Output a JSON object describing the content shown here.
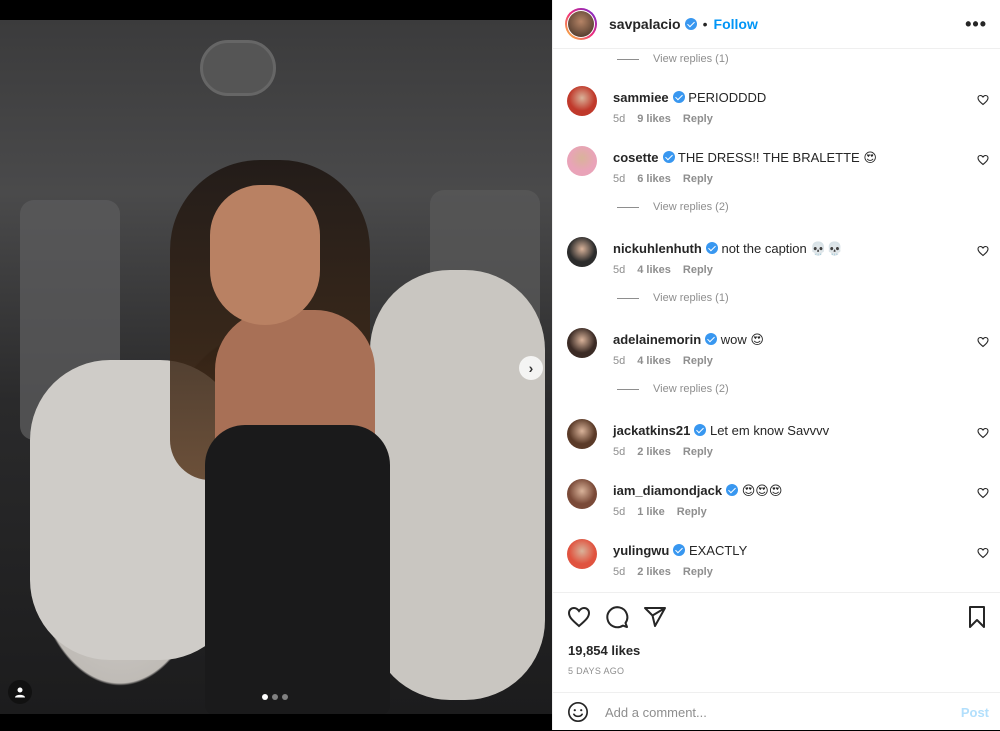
{
  "post": {
    "author": "savpalacio",
    "follow_label": "Follow",
    "separator": "•",
    "more_label": "•••",
    "likes": "19,854 likes",
    "timestamp": "5 DAYS AGO",
    "carousel": {
      "total": 3,
      "active": 0
    }
  },
  "replies_top": {
    "label": "View replies (1)"
  },
  "comments": [
    {
      "user": "sammiee",
      "text": "PERIODDDD",
      "age": "5d",
      "likes": "9 likes",
      "reply": "Reply",
      "avatar_color": "#c0392b"
    },
    {
      "user": "cosette",
      "text": "THE DRESS!! THE BRALETTE 😍",
      "age": "5d",
      "likes": "6 likes",
      "reply": "Reply",
      "avatar_color": "#e9a3b8",
      "replies": "View replies (2)"
    },
    {
      "user": "nickuhlenhuth",
      "text": "not the caption 💀💀",
      "age": "5d",
      "likes": "4 likes",
      "reply": "Reply",
      "avatar_color": "#2c2c2c",
      "replies": "View replies (1)"
    },
    {
      "user": "adelainemorin",
      "text": "wow 😍",
      "age": "5d",
      "likes": "4 likes",
      "reply": "Reply",
      "avatar_color": "#3b2b25",
      "replies": "View replies (2)"
    },
    {
      "user": "jackatkins21",
      "text": "Let em know Savvvv",
      "age": "5d",
      "likes": "2 likes",
      "reply": "Reply",
      "avatar_color": "#5a3a28"
    },
    {
      "user": "iam_diamondjack",
      "text": "😍😍😍",
      "age": "5d",
      "likes": "1 like",
      "reply": "Reply",
      "avatar_color": "#7a4a38"
    },
    {
      "user": "yulingwu",
      "text": "EXACTLY",
      "age": "5d",
      "likes": "2 likes",
      "reply": "Reply",
      "avatar_color": "#e0533f"
    }
  ],
  "composer": {
    "placeholder": "Add a comment...",
    "post_label": "Post"
  },
  "colors": {
    "accent": "#0095f6",
    "verified": "#3897f0",
    "muted": "#8e8e8e",
    "post_disabled": "#b2dffc"
  }
}
